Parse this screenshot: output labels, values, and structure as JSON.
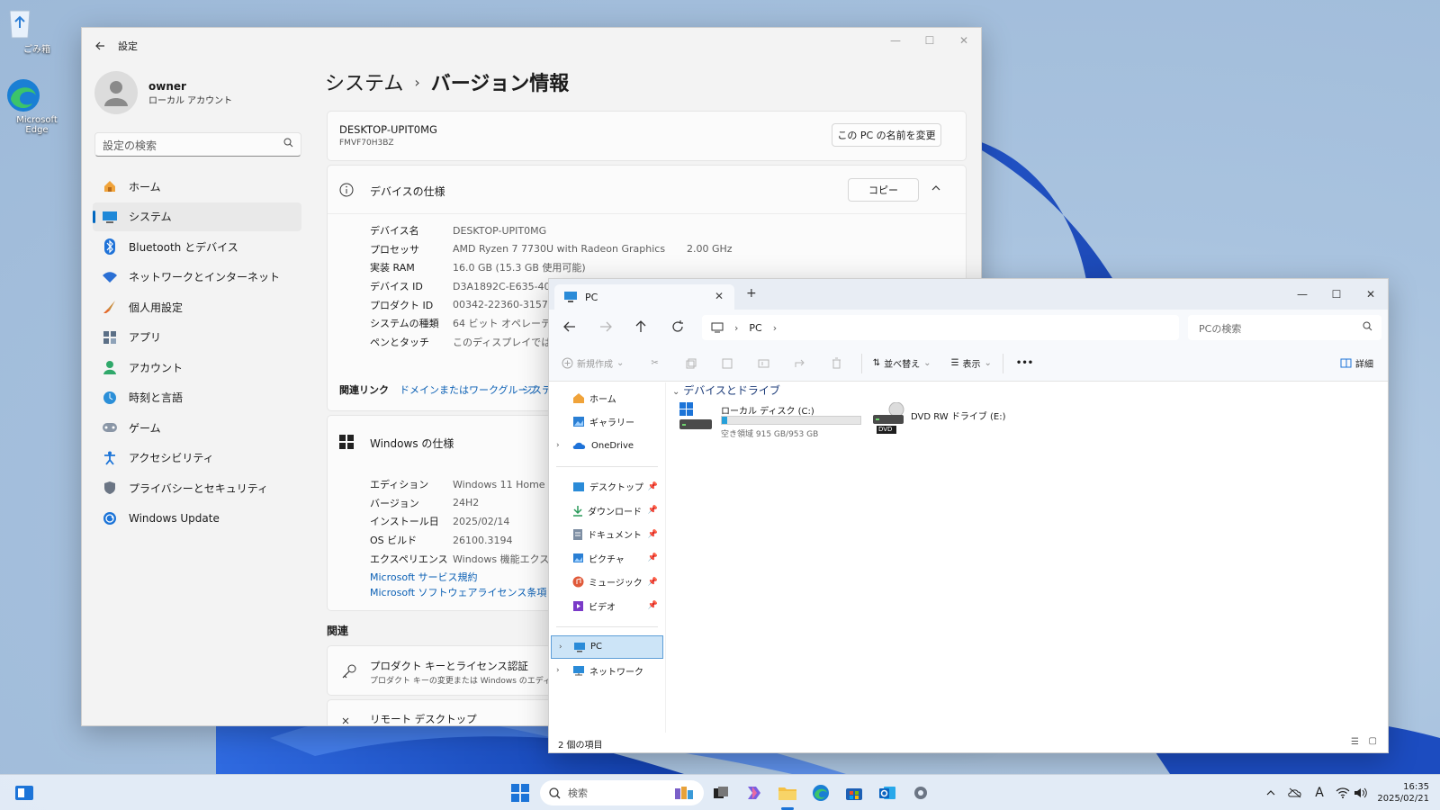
{
  "desktop": {
    "icons": [
      {
        "label": "ごみ箱"
      },
      {
        "label": "Microsoft Edge"
      }
    ]
  },
  "settings": {
    "title": "設定",
    "user": {
      "name": "owner",
      "account_type": "ローカル アカウント"
    },
    "search_placeholder": "設定の検索",
    "nav": [
      {
        "label": "ホーム",
        "icon": "home-icon"
      },
      {
        "label": "システム",
        "icon": "system-icon",
        "active": true
      },
      {
        "label": "Bluetooth とデバイス",
        "icon": "bluetooth-icon"
      },
      {
        "label": "ネットワークとインターネット",
        "icon": "network-icon"
      },
      {
        "label": "個人用設定",
        "icon": "brush-icon"
      },
      {
        "label": "アプリ",
        "icon": "apps-icon"
      },
      {
        "label": "アカウント",
        "icon": "account-icon"
      },
      {
        "label": "時刻と言語",
        "icon": "clock-globe-icon"
      },
      {
        "label": "ゲーム",
        "icon": "gamepad-icon"
      },
      {
        "label": "アクセシビリティ",
        "icon": "accessibility-icon"
      },
      {
        "label": "プライバシーとセキュリティ",
        "icon": "shield-icon"
      },
      {
        "label": "Windows Update",
        "icon": "update-icon"
      }
    ],
    "breadcrumb": {
      "parent": "システム",
      "separator": "›",
      "current": "バージョン情報"
    },
    "device_card": {
      "name": "DESKTOP-UPIT0MG",
      "model": "FMVF70H3BZ",
      "rename_button": "この PC の名前を変更"
    },
    "device_spec": {
      "title": "デバイスの仕様",
      "copy_button": "コピー",
      "rows": [
        {
          "key": "デバイス名",
          "value": "DESKTOP-UPIT0MG",
          "extra": ""
        },
        {
          "key": "プロセッサ",
          "value": "AMD Ryzen 7 7730U with Radeon Graphics",
          "extra": "2.00 GHz"
        },
        {
          "key": "実装 RAM",
          "value": "16.0 GB (15.3 GB 使用可能)",
          "extra": ""
        },
        {
          "key": "デバイス ID",
          "value": "D3A1892C-E635-409",
          "extra": ""
        },
        {
          "key": "プロダクト ID",
          "value": "00342-22360-31572",
          "extra": ""
        },
        {
          "key": "システムの種類",
          "value": "64 ビット オペレーティン",
          "extra": ""
        },
        {
          "key": "ペンとタッチ",
          "value": "このディスプレイでは、",
          "extra": ""
        }
      ]
    },
    "related_links": {
      "label": "関連リンク",
      "links": [
        "ドメインまたはワークグループ",
        "システ"
      ]
    },
    "windows_spec": {
      "title": "Windows の仕様",
      "rows": [
        {
          "key": "エディション",
          "value": "Windows 11 Home"
        },
        {
          "key": "バージョン",
          "value": "24H2"
        },
        {
          "key": "インストール日",
          "value": "2025/02/14"
        },
        {
          "key": "OS ビルド",
          "value": "26100.3194"
        },
        {
          "key": "エクスペリエンス",
          "value": "Windows 機能エクス"
        }
      ],
      "links": [
        "Microsoft サービス規約",
        "Microsoft ソフトウェアライセンス条項"
      ]
    },
    "related": {
      "heading": "関連",
      "items": [
        {
          "title": "プロダクト キーとライセンス認証",
          "subtitle": "プロダクト キーの変更または Windows のエディシ"
        },
        {
          "title": "リモート デスクトップ",
          "subtitle": ""
        }
      ]
    }
  },
  "explorer": {
    "tab_title": "PC",
    "new_tab": "+",
    "address": {
      "crumb": "PC"
    },
    "search_placeholder": "PCの検索",
    "commands": {
      "new": "新規作成",
      "sort": "並べ替え",
      "view": "表示",
      "more": "•••",
      "details": "詳細"
    },
    "sidebar": {
      "top": [
        {
          "label": "ホーム",
          "icon": "home-icon",
          "chevron": false
        },
        {
          "label": "ギャラリー",
          "icon": "gallery-icon",
          "chevron": false
        },
        {
          "label": "OneDrive",
          "icon": "cloud-icon",
          "chevron": true
        }
      ],
      "pinned": [
        {
          "label": "デスクトップ",
          "icon": "desktop-folder-icon"
        },
        {
          "label": "ダウンロード",
          "icon": "download-icon"
        },
        {
          "label": "ドキュメント",
          "icon": "document-icon"
        },
        {
          "label": "ピクチャ",
          "icon": "picture-icon"
        },
        {
          "label": "ミュージック",
          "icon": "music-icon"
        },
        {
          "label": "ビデオ",
          "icon": "video-icon"
        }
      ],
      "bottom": [
        {
          "label": "PC",
          "icon": "pc-icon",
          "selected": true
        },
        {
          "label": "ネットワーク",
          "icon": "network-folder-icon",
          "selected": false
        }
      ]
    },
    "group_header": "デバイスとドライブ",
    "drives": [
      {
        "name": "ローカル ディスク (C:)",
        "free_text": "空き領域 915 GB/953 GB",
        "used_fraction": 0.04
      },
      {
        "name": "DVD RW ドライブ (E:)",
        "badge": "DVD"
      }
    ],
    "status": "2 個の項目"
  },
  "taskbar": {
    "search_placeholder": "検索",
    "time": "16:35",
    "date": "2025/02/21",
    "ime": "A"
  }
}
